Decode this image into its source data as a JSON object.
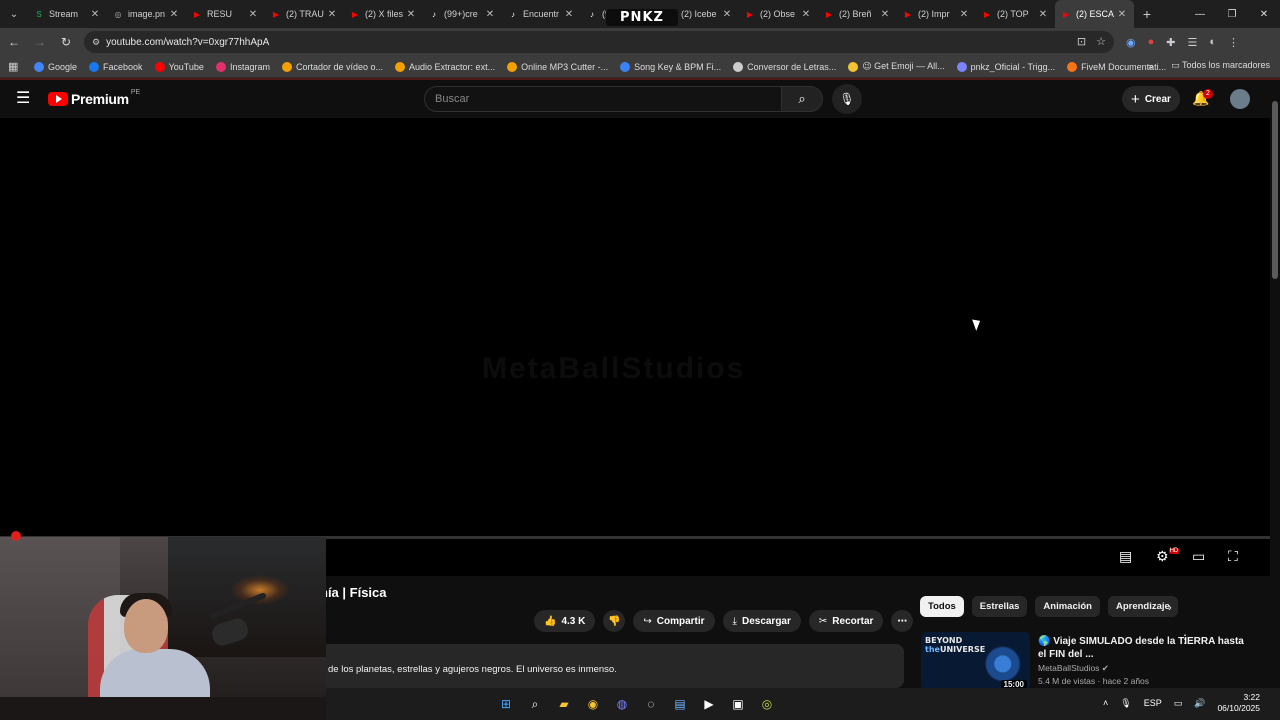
{
  "browser": {
    "tabs": [
      {
        "title": "Stream",
        "color": "#1db954",
        "icon": "S"
      },
      {
        "title": "image.pn",
        "color": "#aaaaaa",
        "icon": "◎"
      },
      {
        "title": "RESU",
        "color": "#ff0000",
        "icon": "▶"
      },
      {
        "title": "(2) TRAU",
        "color": "#ff0000",
        "icon": "▶"
      },
      {
        "title": "(2) X files",
        "color": "#ff0000",
        "icon": "▶"
      },
      {
        "title": "(99+)cre",
        "color": "#ffffff",
        "icon": "♪"
      },
      {
        "title": "Encuentr",
        "color": "#ffffff",
        "icon": "♪"
      },
      {
        "title": "(99+)La",
        "color": "#ffffff",
        "icon": "♪"
      },
      {
        "title": "(2) Icebe",
        "color": "#ff0000",
        "icon": "▶"
      },
      {
        "title": "(2) Obse",
        "color": "#ff0000",
        "icon": "▶"
      },
      {
        "title": "(2) Breñ",
        "color": "#ff0000",
        "icon": "▶"
      },
      {
        "title": "(2) Impr",
        "color": "#ff0000",
        "icon": "▶"
      },
      {
        "title": "(2) TOP",
        "color": "#ff0000",
        "icon": "▶"
      },
      {
        "title": "(2) ESCA",
        "color": "#ff0000",
        "icon": "▶",
        "active": true
      }
    ],
    "url": "youtube.com/watch?v=0xgr77hhApA",
    "overlay_logo": "PNKZ",
    "bookmarks": [
      {
        "label": "Google",
        "color": "#4285f4"
      },
      {
        "label": "Facebook",
        "color": "#1877f2"
      },
      {
        "label": "YouTube",
        "color": "#ff0000"
      },
      {
        "label": "Instagram",
        "color": "#e1306c"
      },
      {
        "label": "Cortador de vídeo o...",
        "color": "#f4a100"
      },
      {
        "label": "Audio Extractor: ext...",
        "color": "#f4a100"
      },
      {
        "label": "Online MP3 Cutter -...",
        "color": "#f4a100"
      },
      {
        "label": "Song Key & BPM Fi...",
        "color": "#3b82f6"
      },
      {
        "label": "Conversor de Letras...",
        "color": "#cccccc"
      },
      {
        "label": "😉 Get Emoji — All...",
        "color": "#f4c430"
      },
      {
        "label": "pnkz_Oficial - Trigg...",
        "color": "#7c83ff"
      },
      {
        "label": "FiveM Documentati...",
        "color": "#f97316"
      }
    ],
    "all_bookmarks": "Todos los marcadores"
  },
  "youtube": {
    "brand": "Premium",
    "region": "PE",
    "search_placeholder": "Buscar",
    "create_label": "Crear",
    "notif_count": "2",
    "video_watermark": "MetaBallStudios",
    "video_title_visible": "nía | Física",
    "actions": {
      "likes": "4.3 K",
      "share": "Compartir",
      "download": "Descargar",
      "clip": "Recortar"
    },
    "description": "de los planetas, estrellas y agujeros negros. El universo es inmenso.",
    "chips": [
      {
        "label": "Todos",
        "active": true
      },
      {
        "label": "Estrellas"
      },
      {
        "label": "Animación"
      },
      {
        "label": "Aprendizaje"
      }
    ],
    "recommendation": {
      "thumb_text_1": "BEYOND",
      "thumb_text_2": "the",
      "thumb_text_3": "UNIVERSE",
      "duration": "15:00",
      "title": "🌎 Viaje SIMULADO desde la TIERRA hasta el FIN del ...",
      "channel": "MetaBallStudios",
      "meta": "5.4 M de vistas · hace 2 años"
    }
  },
  "taskbar": {
    "lang": "ESP",
    "time": "3:22",
    "date": "06/10/2025"
  }
}
